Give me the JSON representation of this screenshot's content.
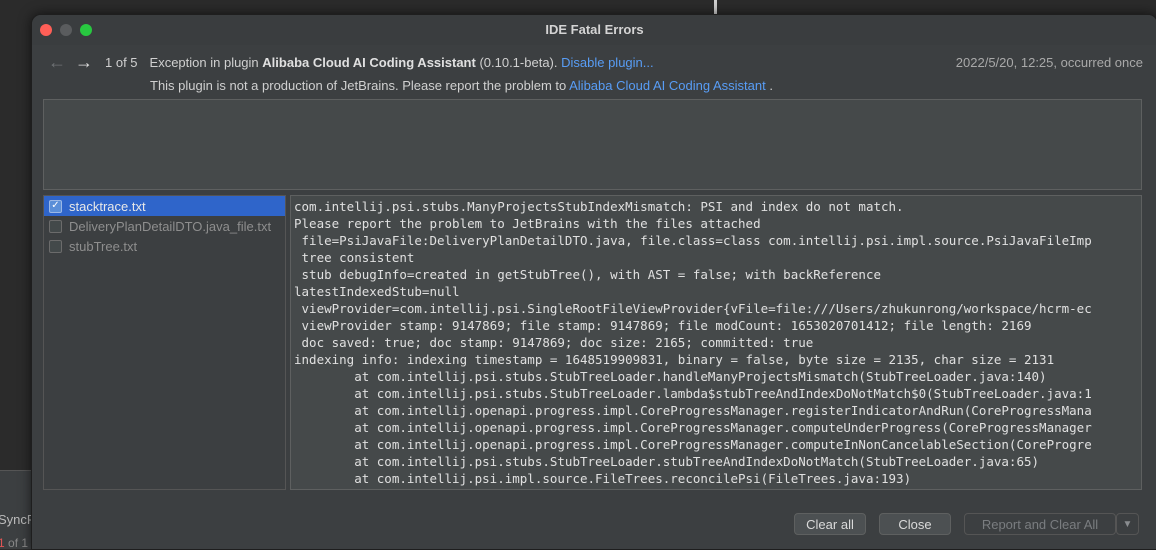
{
  "background": {
    "sync_label": "SyncP",
    "page_label_red": "1",
    "page_label_rest": " of 1"
  },
  "dialog": {
    "title": "IDE Fatal Errors",
    "nav": {
      "back_icon": "arrow-left-icon",
      "forward_icon": "arrow-right-icon",
      "count": "1 of 5"
    },
    "header": {
      "prefix": "Exception in plugin ",
      "plugin_name": "Alibaba Cloud AI Coding Assistant",
      "version": " (0.10.1-beta). ",
      "disable_link": "Disable plugin...",
      "date": "2022/5/20, 12:25, occurred once",
      "notice_prefix": "This plugin is not a production of JetBrains. Please report the problem to ",
      "notice_link": "Alibaba Cloud AI Coding Assistant",
      "notice_suffix": " ."
    },
    "comment_placeholder": "",
    "files": [
      {
        "name": "stacktrace.txt",
        "checked": true,
        "selected": true
      },
      {
        "name": "DeliveryPlanDetailDTO.java_file.txt",
        "checked": false,
        "selected": false
      },
      {
        "name": "stubTree.txt",
        "checked": false,
        "selected": false
      }
    ],
    "trace_lines": [
      "com.intellij.psi.stubs.ManyProjectsStubIndexMismatch: PSI and index do not match.",
      "Please report the problem to JetBrains with the files attached",
      " file=PsiJavaFile:DeliveryPlanDetailDTO.java, file.class=class com.intellij.psi.impl.source.PsiJavaFileImp",
      " tree consistent",
      " stub debugInfo=created in getStubTree(), with AST = false; with backReference",
      "latestIndexedStub=null",
      " viewProvider=com.intellij.psi.SingleRootFileViewProvider{vFile=file:///Users/zhukunrong/workspace/hcrm-ec",
      " viewProvider stamp: 9147869; file stamp: 9147869; file modCount: 1653020701412; file length: 2169",
      " doc saved: true; doc stamp: 9147869; doc size: 2165; committed: true",
      "indexing info: indexing timestamp = 1648519909831, binary = false, byte size = 2135, char size = 2131",
      "        at com.intellij.psi.stubs.StubTreeLoader.handleManyProjectsMismatch(StubTreeLoader.java:140)",
      "        at com.intellij.psi.stubs.StubTreeLoader.lambda$stubTreeAndIndexDoNotMatch$0(StubTreeLoader.java:1",
      "        at com.intellij.openapi.progress.impl.CoreProgressManager.registerIndicatorAndRun(CoreProgressMana",
      "        at com.intellij.openapi.progress.impl.CoreProgressManager.computeUnderProgress(CoreProgressManager",
      "        at com.intellij.openapi.progress.impl.CoreProgressManager.computeInNonCancelableSection(CoreProgre",
      "        at com.intellij.psi.stubs.StubTreeLoader.stubTreeAndIndexDoNotMatch(StubTreeLoader.java:65)",
      "        at com.intellij.psi.impl.source.FileTrees.reconcilePsi(FileTrees.java:193)"
    ],
    "buttons": {
      "clear_all": "Clear all",
      "close": "Close",
      "report": "Report and Clear All",
      "report_dropdown_icon": "chevron-down-icon"
    }
  }
}
